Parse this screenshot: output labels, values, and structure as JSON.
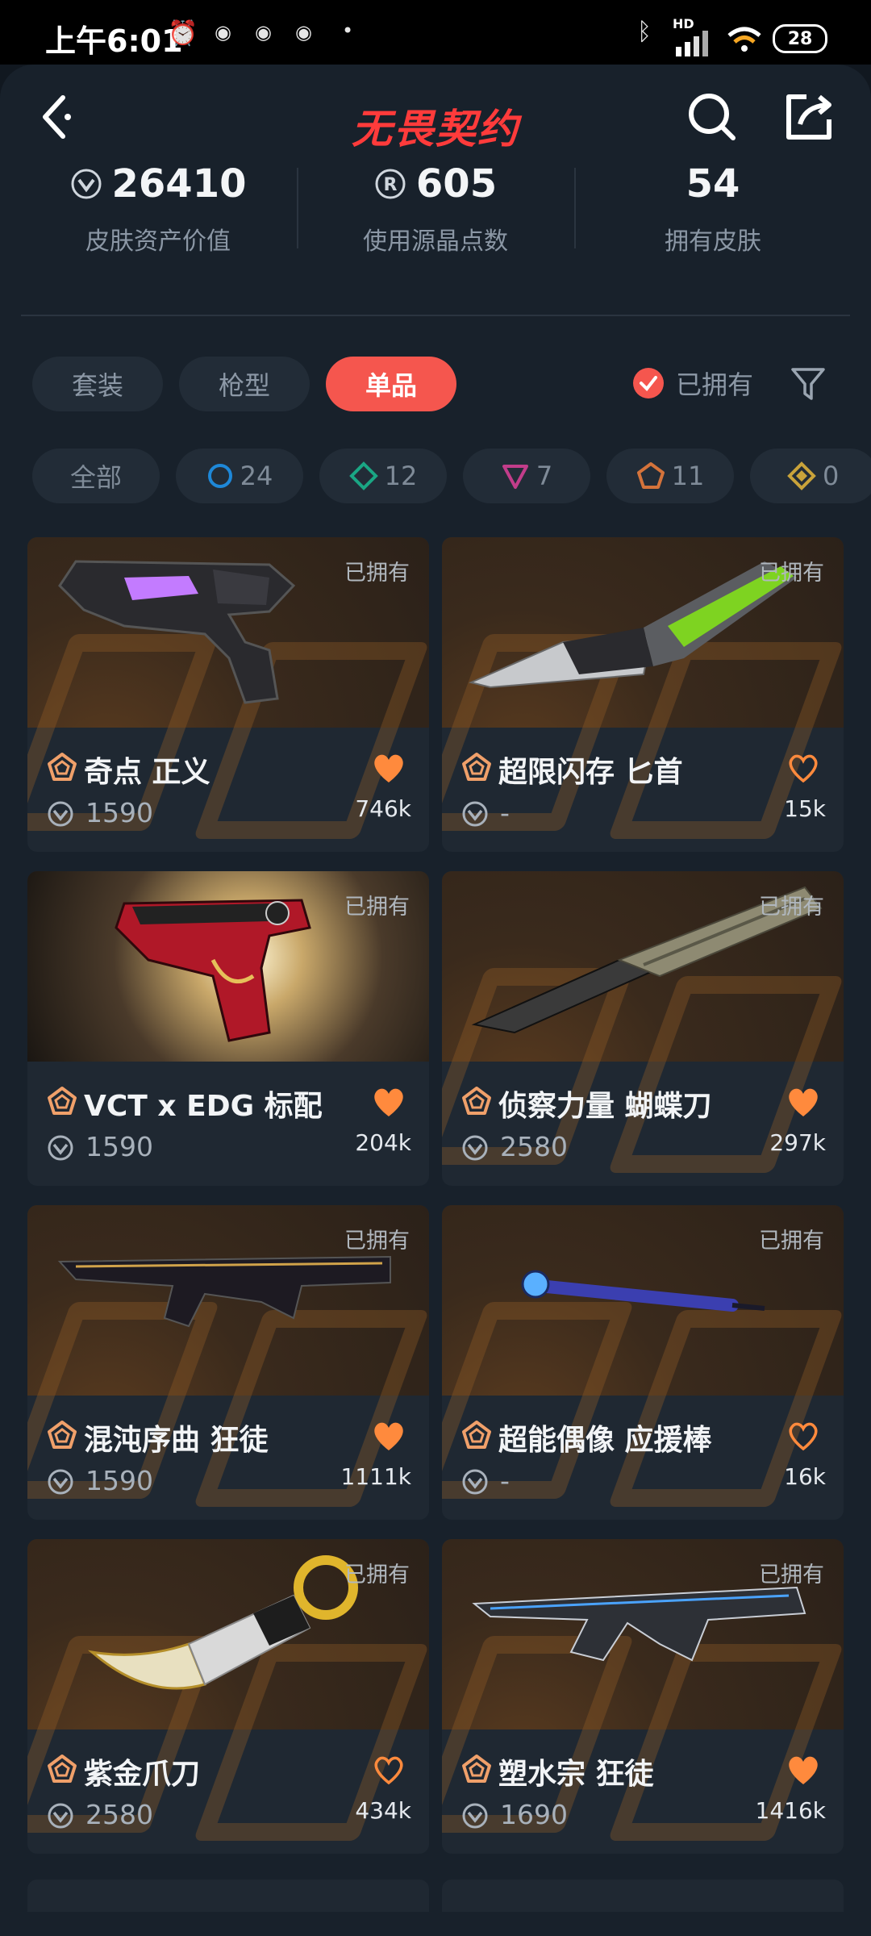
{
  "status": {
    "time": "上午6:01",
    "network_label": "HD",
    "battery": "28"
  },
  "header": {
    "title": "无畏契约"
  },
  "stats": [
    {
      "value": "26410",
      "label": "皮肤资产价值"
    },
    {
      "value": "605",
      "label": "使用源晶点数"
    },
    {
      "value": "54",
      "label": "拥有皮肤"
    }
  ],
  "tabs": [
    "套装",
    "枪型",
    "单品"
  ],
  "owned_filter": {
    "label": "已拥有"
  },
  "tier_filters": [
    {
      "label": "全部"
    },
    {
      "label": "24",
      "color": "#1e88d8"
    },
    {
      "label": "12",
      "color": "#1aa684"
    },
    {
      "label": "7",
      "color": "#c23d8a"
    },
    {
      "label": "11",
      "color": "#d4733b"
    },
    {
      "label": "0",
      "color": "#c9a33a"
    }
  ],
  "items": [
    {
      "name": "奇点 正义",
      "price": "1590",
      "likes": "746k",
      "owned_label": "已拥有",
      "liked": true
    },
    {
      "name": "超限闪存 匕首",
      "price": "-",
      "likes": "15k",
      "owned_label": "已拥有",
      "liked": false
    },
    {
      "name": "VCT x EDG 标配",
      "price": "1590",
      "likes": "204k",
      "owned_label": "已拥有",
      "liked": true
    },
    {
      "name": "侦察力量 蝴蝶刀",
      "price": "2580",
      "likes": "297k",
      "owned_label": "已拥有",
      "liked": true
    },
    {
      "name": "混沌序曲 狂徒",
      "price": "1590",
      "likes": "1111k",
      "owned_label": "已拥有",
      "liked": true
    },
    {
      "name": "超能偶像 应援棒",
      "price": "-",
      "likes": "16k",
      "owned_label": "已拥有",
      "liked": false
    },
    {
      "name": "紫金爪刀",
      "price": "2580",
      "likes": "434k",
      "owned_label": "已拥有",
      "liked": false
    },
    {
      "name": "塑水宗 狂徒",
      "price": "1690",
      "likes": "1416k",
      "owned_label": "已拥有",
      "liked": true
    }
  ],
  "colors": {
    "accent": "#f5564e",
    "heart": "#ff8a3d",
    "tier_icon": "#f0a06a",
    "background": "#18212b"
  }
}
